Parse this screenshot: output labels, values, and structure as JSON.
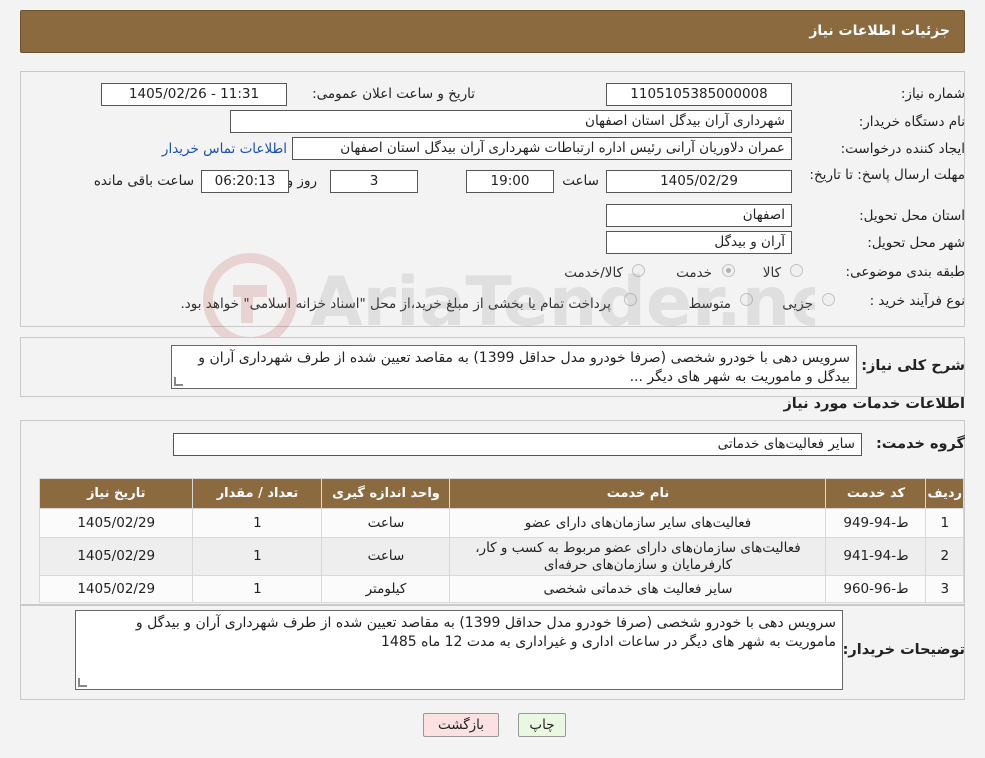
{
  "header": {
    "title": "جزئیات اطلاعات نیاز"
  },
  "form": {
    "need_number_label": "شماره نیاز:",
    "need_number": "1105105385000008",
    "announce_label": "تاریخ و ساعت اعلان عمومی:",
    "announce_value": "1405/02/26 - 11:31",
    "buyer_org_label": "نام دستگاه خریدار:",
    "buyer_org": "شهرداری آران بیدگل استان اصفهان",
    "requester_label": "ایجاد کننده درخواست:",
    "requester": "عمران دلاوریان آرانی رئیس اداره ارتباطات شهرداری آران بیدگل استان اصفهان",
    "contact_link": "اطلاعات تماس خریدار",
    "deadline_label": "مهلت ارسال پاسخ: تا تاریخ:",
    "deadline_date": "1405/02/29",
    "time_label": "ساعت",
    "deadline_time": "19:00",
    "days_value": "3",
    "days_label": "روز و",
    "remaining_time": "06:20:13",
    "remaining_label": "ساعت باقی مانده",
    "province_label": "استان محل تحویل:",
    "province": "اصفهان",
    "city_label": "شهر محل تحویل:",
    "city": "آران و بیدگل",
    "category_label": "طبقه بندی موضوعی:",
    "category_options": [
      "کالا",
      "خدمت",
      "کالا/خدمت"
    ],
    "category_selected": "خدمت",
    "process_label": "نوع فرآیند خرید :",
    "process_options": [
      "جزیی",
      "متوسط"
    ],
    "process_note": "پرداخت تمام یا بخشی از مبلغ خرید،از محل \"اسناد خزانه اسلامی\" خواهد بود."
  },
  "summary": {
    "label": "شرح کلی نیاز:",
    "text": "سرویس دهی با خودرو شخصی (صرفا خودرو مدل حداقل 1399) به مقاصد تعیین شده از طرف شهرداری آران و بیدگل و ماموریت به شهر های دیگر ..."
  },
  "services": {
    "section_title": "اطلاعات خدمات مورد نیاز",
    "group_label": "گروه خدمت:",
    "group_value": "سایر فعالیت‌های خدماتی",
    "columns": [
      "ردیف",
      "کد خدمت",
      "نام خدمت",
      "واحد اندازه گیری",
      "تعداد / مقدار",
      "تاریخ نیاز"
    ],
    "rows": [
      {
        "row": "1",
        "code": "ط-94-949",
        "name": "فعالیت‌های سایر سازمان‌های دارای عضو",
        "unit": "ساعت",
        "qty": "1",
        "date": "1405/02/29"
      },
      {
        "row": "2",
        "code": "ط-94-941",
        "name": "فعالیت‌های سازمان‌های دارای عضو مربوط به کسب و کار، کارفرمایان و سازمان‌های حرفه‌ای",
        "unit": "ساعت",
        "qty": "1",
        "date": "1405/02/29"
      },
      {
        "row": "3",
        "code": "ط-96-960",
        "name": "سایر فعالیت های خدماتی شخصی",
        "unit": "کیلومتر",
        "qty": "1",
        "date": "1405/02/29"
      }
    ]
  },
  "buyer_notes": {
    "label": "توضیحات خریدار:",
    "text": "سرویس دهی با خودرو شخصی (صرفا خودرو مدل حداقل 1399) به مقاصد تعیین شده از طرف شهرداری آران و بیدگل و ماموریت به شهر های دیگر در ساعات اداری و غیراداری به مدت 12 ماه 1485"
  },
  "buttons": {
    "print": "چاپ",
    "back": "بازگشت"
  },
  "watermark": {
    "text": "AriaTender.neT"
  }
}
